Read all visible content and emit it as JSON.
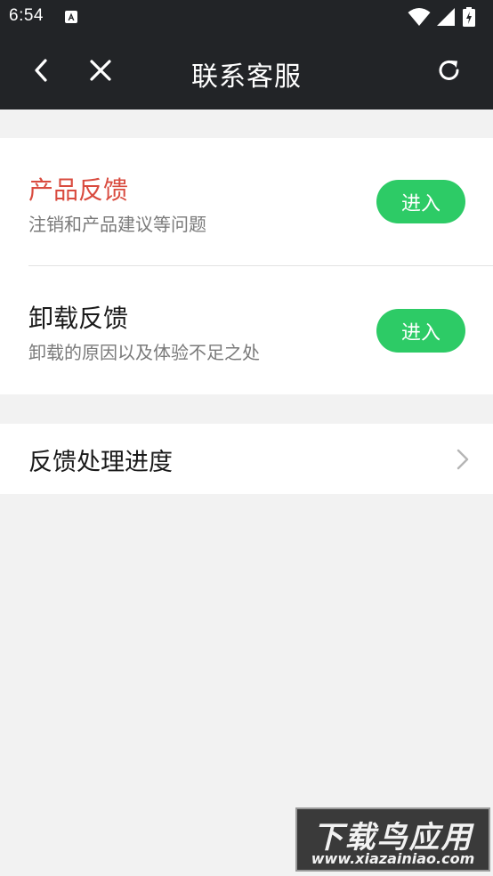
{
  "status_bar": {
    "time": "6:54",
    "icons": [
      "app-notification-icon",
      "wifi-icon",
      "signal-icon",
      "battery-charging-icon"
    ]
  },
  "nav": {
    "title": "联系客服",
    "icons": [
      "back-arrow-icon",
      "close-icon",
      "refresh-icon"
    ]
  },
  "feedback_items": [
    {
      "title": "产品反馈",
      "subtitle": "注销和产品建议等问题",
      "button_label": "进入"
    },
    {
      "title": "卸载反馈",
      "subtitle": "卸载的原因以及体验不足之处",
      "button_label": "进入"
    }
  ],
  "progress": {
    "label": "反馈处理进度"
  },
  "watermark": {
    "title": "下载鸟应用",
    "url": "www.xiazainiao.com"
  },
  "colors": {
    "header_bg": "#222427",
    "accent_red": "#d94b3f",
    "button_green": "#2dcb66",
    "page_bg": "#f2f2f2"
  }
}
